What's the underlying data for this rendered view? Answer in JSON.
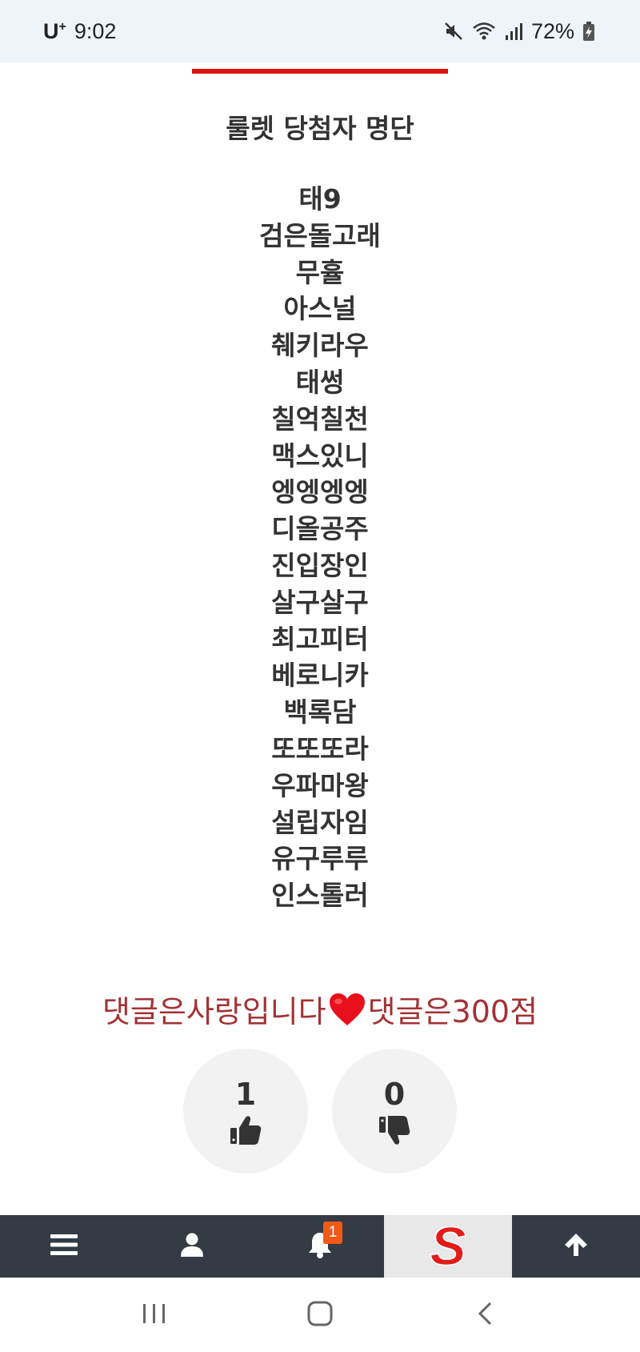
{
  "status_bar": {
    "carrier": "U",
    "carrier_sup": "+",
    "time": "9:02",
    "battery": "72%"
  },
  "article": {
    "list_title": "룰렛 당첨자 명단",
    "winners": [
      "태9",
      "검은돌고래",
      "무휼",
      "아스널",
      "췌키라우",
      "태썽",
      "칠억칠천",
      "맥스있니",
      "엥엥엥엥",
      "디올공주",
      "진입장인",
      "살구살구",
      "최고피터",
      "베로니카",
      "백록담",
      "또또또라",
      "우파마왕",
      "설립자임",
      "유구루루",
      "인스톨러"
    ],
    "comment_note_left": "댓글은사랑입니다",
    "comment_note_right": "댓글은300점",
    "heart_icon": "red-heart-emoji"
  },
  "votes": {
    "up_count": "1",
    "down_count": "0"
  },
  "bottom_nav": {
    "notification_count": "1",
    "logo_letter": "S"
  },
  "colors": {
    "nav_bg": "#343b45",
    "note_red": "#a33235",
    "badge_orange": "#f05a16",
    "status_bg": "#eff4fa"
  }
}
